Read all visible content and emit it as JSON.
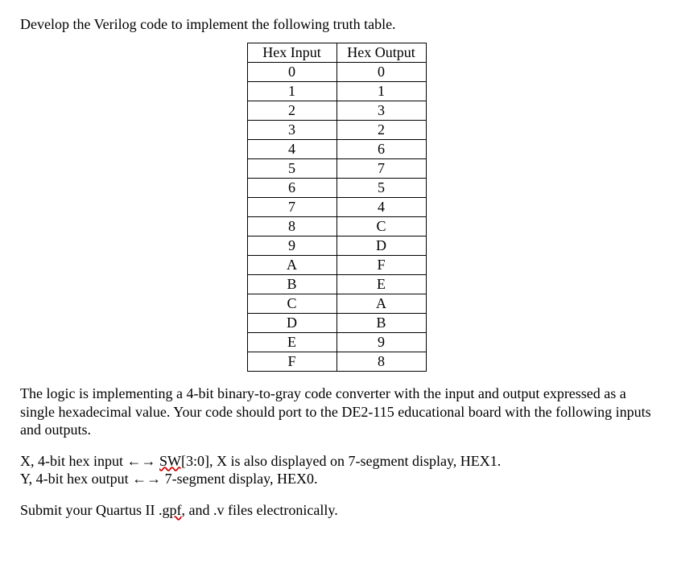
{
  "intro": "Develop the Verilog code to implement the following truth table.",
  "table": {
    "headers": [
      "Hex Input",
      "Hex Output"
    ],
    "rows": [
      [
        "0",
        "0"
      ],
      [
        "1",
        "1"
      ],
      [
        "2",
        "3"
      ],
      [
        "3",
        "2"
      ],
      [
        "4",
        "6"
      ],
      [
        "5",
        "7"
      ],
      [
        "6",
        "5"
      ],
      [
        "7",
        "4"
      ],
      [
        "8",
        "C"
      ],
      [
        "9",
        "D"
      ],
      [
        "A",
        "F"
      ],
      [
        "B",
        "E"
      ],
      [
        "C",
        "A"
      ],
      [
        "D",
        "B"
      ],
      [
        "E",
        "9"
      ],
      [
        "F",
        "8"
      ]
    ]
  },
  "description": "The logic is implementing a 4-bit binary-to-gray code converter with the input and output expressed as a single hexadecimal value.  Your code should port to the DE2-115 educational board with the following inputs and outputs.",
  "io": {
    "x_prefix": "X, 4-bit hex input ",
    "x_sw": "SW[",
    "x_suffix": "3:0], X is also displayed on 7-segment display, HEX1.",
    "y_prefix": "Y, 4-bit hex output ",
    "y_suffix": " 7-segment display, HEX0."
  },
  "arrow": "←→",
  "submit_prefix": "Submit your Quartus II .",
  "submit_gpf": "gpf",
  "submit_suffix": ", and .v files electronically."
}
